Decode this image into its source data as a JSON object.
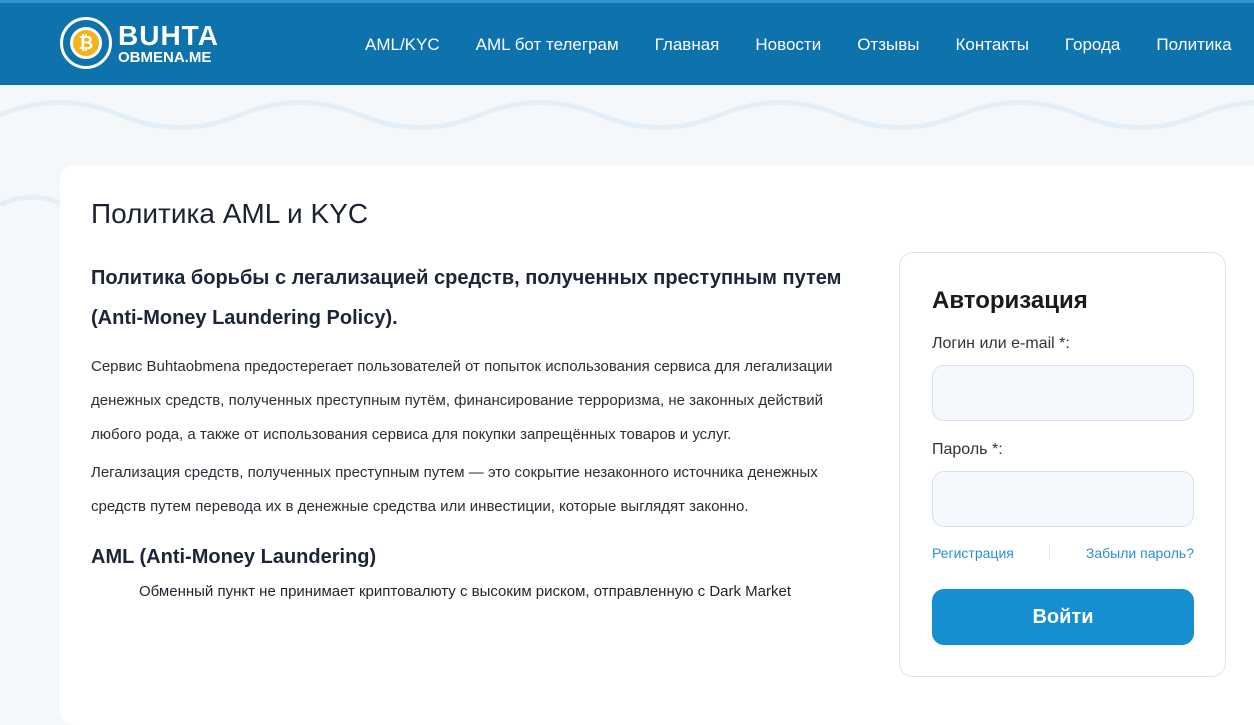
{
  "logo": {
    "line1": "BUHTA",
    "line2": "OBMENA.ME",
    "coin": "₿"
  },
  "nav": [
    "AML/KYC",
    "AML бот телеграм",
    "Главная",
    "Новости",
    "Отзывы",
    "Контакты",
    "Города",
    "Политика"
  ],
  "page_title": "Политика AML и KYC",
  "content": {
    "heading": "Политика борьбы с легализацией средств, полученных преступным путем (Anti-Money Laundering Policy).",
    "p1": "Сервис Buhtaobmena предостерегает пользователей от попыток использования сервиса для легализации денежных средств, полученных преступным путём, финансирование терроризма, не законных действий любого рода, а также от использования сервиса для покупки запрещённых товаров и услуг.",
    "p2": "Легализация средств, полученных преступным путем — это сокрытие незаконного источника денежных средств путем перевода их в денежные средства или инвестиции, которые выглядят законно.",
    "h3": "AML (Anti-Money Laundering)",
    "p3": "Обменный пункт не принимает криптовалюту с высоким риском, отправленную с Dark Market"
  },
  "auth": {
    "title": "Авторизация",
    "login_label": "Логин или e-mail *:",
    "password_label": "Пароль *:",
    "register": "Регистрация",
    "forgot": "Забыли пароль?",
    "submit": "Войти"
  }
}
